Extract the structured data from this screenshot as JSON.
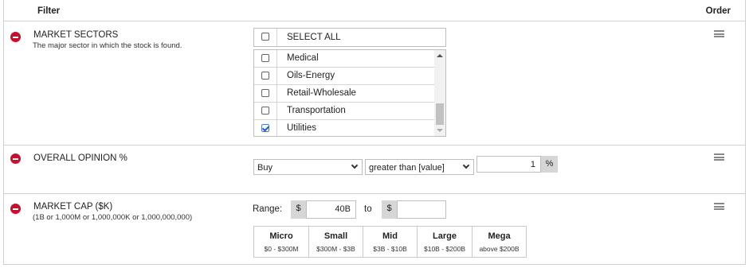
{
  "header": {
    "filter": "Filter",
    "order": "Order"
  },
  "market_sectors": {
    "title": "MARKET SECTORS",
    "subtitle": "The major sector in which the stock is found.",
    "select_all": "SELECT ALL",
    "items": [
      {
        "label": "Medical",
        "checked": false
      },
      {
        "label": "Oils-Energy",
        "checked": false
      },
      {
        "label": "Retail-Wholesale",
        "checked": false
      },
      {
        "label": "Transportation",
        "checked": false
      },
      {
        "label": "Utilities",
        "checked": true
      }
    ]
  },
  "overall_opinion": {
    "title": "OVERALL OPINION %",
    "opinion_select": "Buy",
    "operator_select": "greater than [value]",
    "value": "1",
    "unit": "%"
  },
  "market_cap": {
    "title": "MARKET CAP ($K)",
    "subtitle": "(1B or 1,000M or 1,000,000K or 1,000,000,000)",
    "range_label": "Range:",
    "currency": "$",
    "from_value": "40B",
    "to_label": "to",
    "to_value": "",
    "presets": [
      {
        "name": "Micro",
        "range": "$0 - $300M"
      },
      {
        "name": "Small",
        "range": "$300M - $3B"
      },
      {
        "name": "Mid",
        "range": "$3B - $10B"
      },
      {
        "name": "Large",
        "range": "$10B - $200B"
      },
      {
        "name": "Mega",
        "range": "above $200B"
      }
    ]
  },
  "colors": {
    "remove": "#c8102e",
    "check": "#1a5fd6",
    "addon": "#d6d6d6",
    "border": "#d0d0d0"
  }
}
